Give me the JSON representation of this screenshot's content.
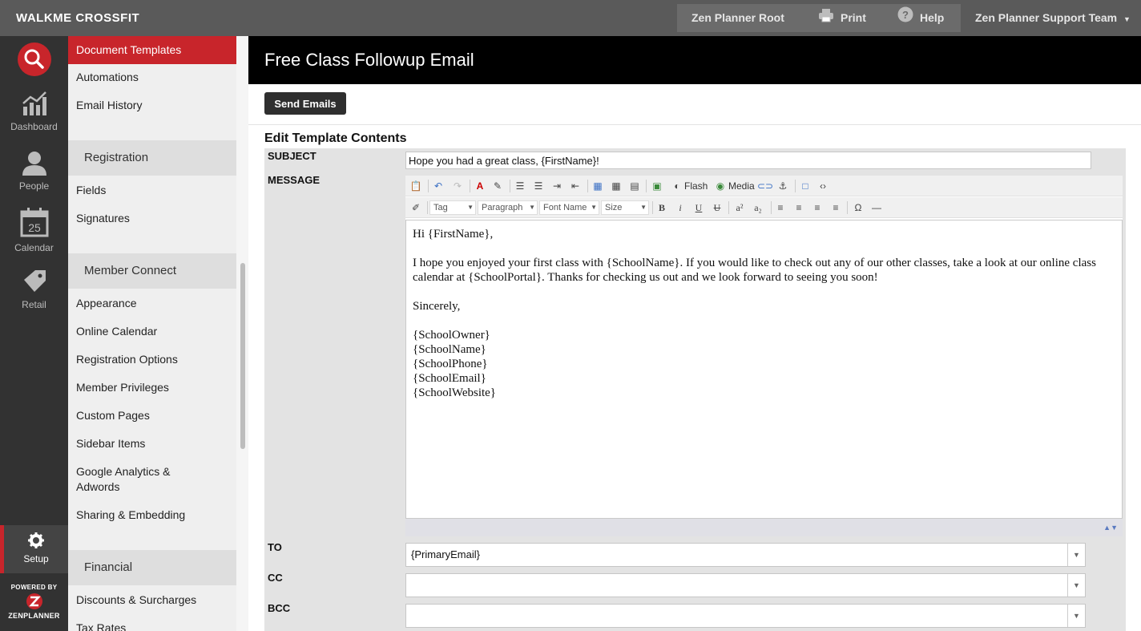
{
  "app": {
    "brand": "WALKME CROSSFIT"
  },
  "topbar": {
    "root_label": "Zen Planner Root",
    "print_label": "Print",
    "help_label": "Help",
    "user_label": "Zen Planner Support Team"
  },
  "rail": {
    "items": [
      {
        "label": "Dashboard",
        "icon": "chart-icon"
      },
      {
        "label": "People",
        "icon": "person-icon"
      },
      {
        "label": "Calendar",
        "icon": "calendar-icon",
        "day": "25"
      },
      {
        "label": "Retail",
        "icon": "tag-icon"
      }
    ],
    "setup_label": "Setup",
    "powered_by": "POWERED BY",
    "logo_text": "ZENPLANNER"
  },
  "sidebar": {
    "active": "Document Templates",
    "links_top": [
      "Automations",
      "Email History"
    ],
    "sections": [
      {
        "title": "Registration",
        "items": [
          "Fields",
          "Signatures"
        ]
      },
      {
        "title": "Member Connect",
        "items": [
          "Appearance",
          "Online Calendar",
          "Registration Options",
          "Member Privileges",
          "Custom Pages",
          "Sidebar Items",
          "Google Analytics & Adwords",
          "Sharing & Embedding"
        ]
      },
      {
        "title": "Financial",
        "items": [
          "Discounts & Surcharges",
          "Tax Rates"
        ]
      }
    ]
  },
  "page": {
    "title": "Free Class Followup Email",
    "send_button": "Send Emails",
    "section_title": "Edit Template Contents"
  },
  "form": {
    "subject_label": "SUBJECT",
    "subject_value": "Hope you had a great class, {FirstName}!",
    "message_label": "MESSAGE",
    "to_label": "TO",
    "to_value": "{PrimaryEmail}",
    "cc_label": "CC",
    "cc_value": "",
    "bcc_label": "BCC",
    "bcc_value": ""
  },
  "editor": {
    "toolbar": {
      "flash_label": "Flash",
      "media_label": "Media",
      "tag_select": "Tag",
      "format_select": "Paragraph",
      "font_select": "Font Name",
      "size_select": "Size"
    },
    "body": {
      "greeting": "Hi {FirstName},",
      "paragraph": "I hope you enjoyed your first class with {SchoolName}. If you would like to check out any of our other classes, take a look at our online class calendar at {SchoolPortal}. Thanks for checking us out and we look forward to seeing you soon!",
      "closing": "Sincerely,",
      "signature": [
        "{SchoolOwner}",
        "{SchoolName}",
        "{SchoolPhone}",
        "{SchoolEmail}",
        "{SchoolWebsite}"
      ]
    }
  },
  "colors": {
    "accent": "#c8252b",
    "rail": "#323232",
    "topbar": "#5a5a5a"
  }
}
